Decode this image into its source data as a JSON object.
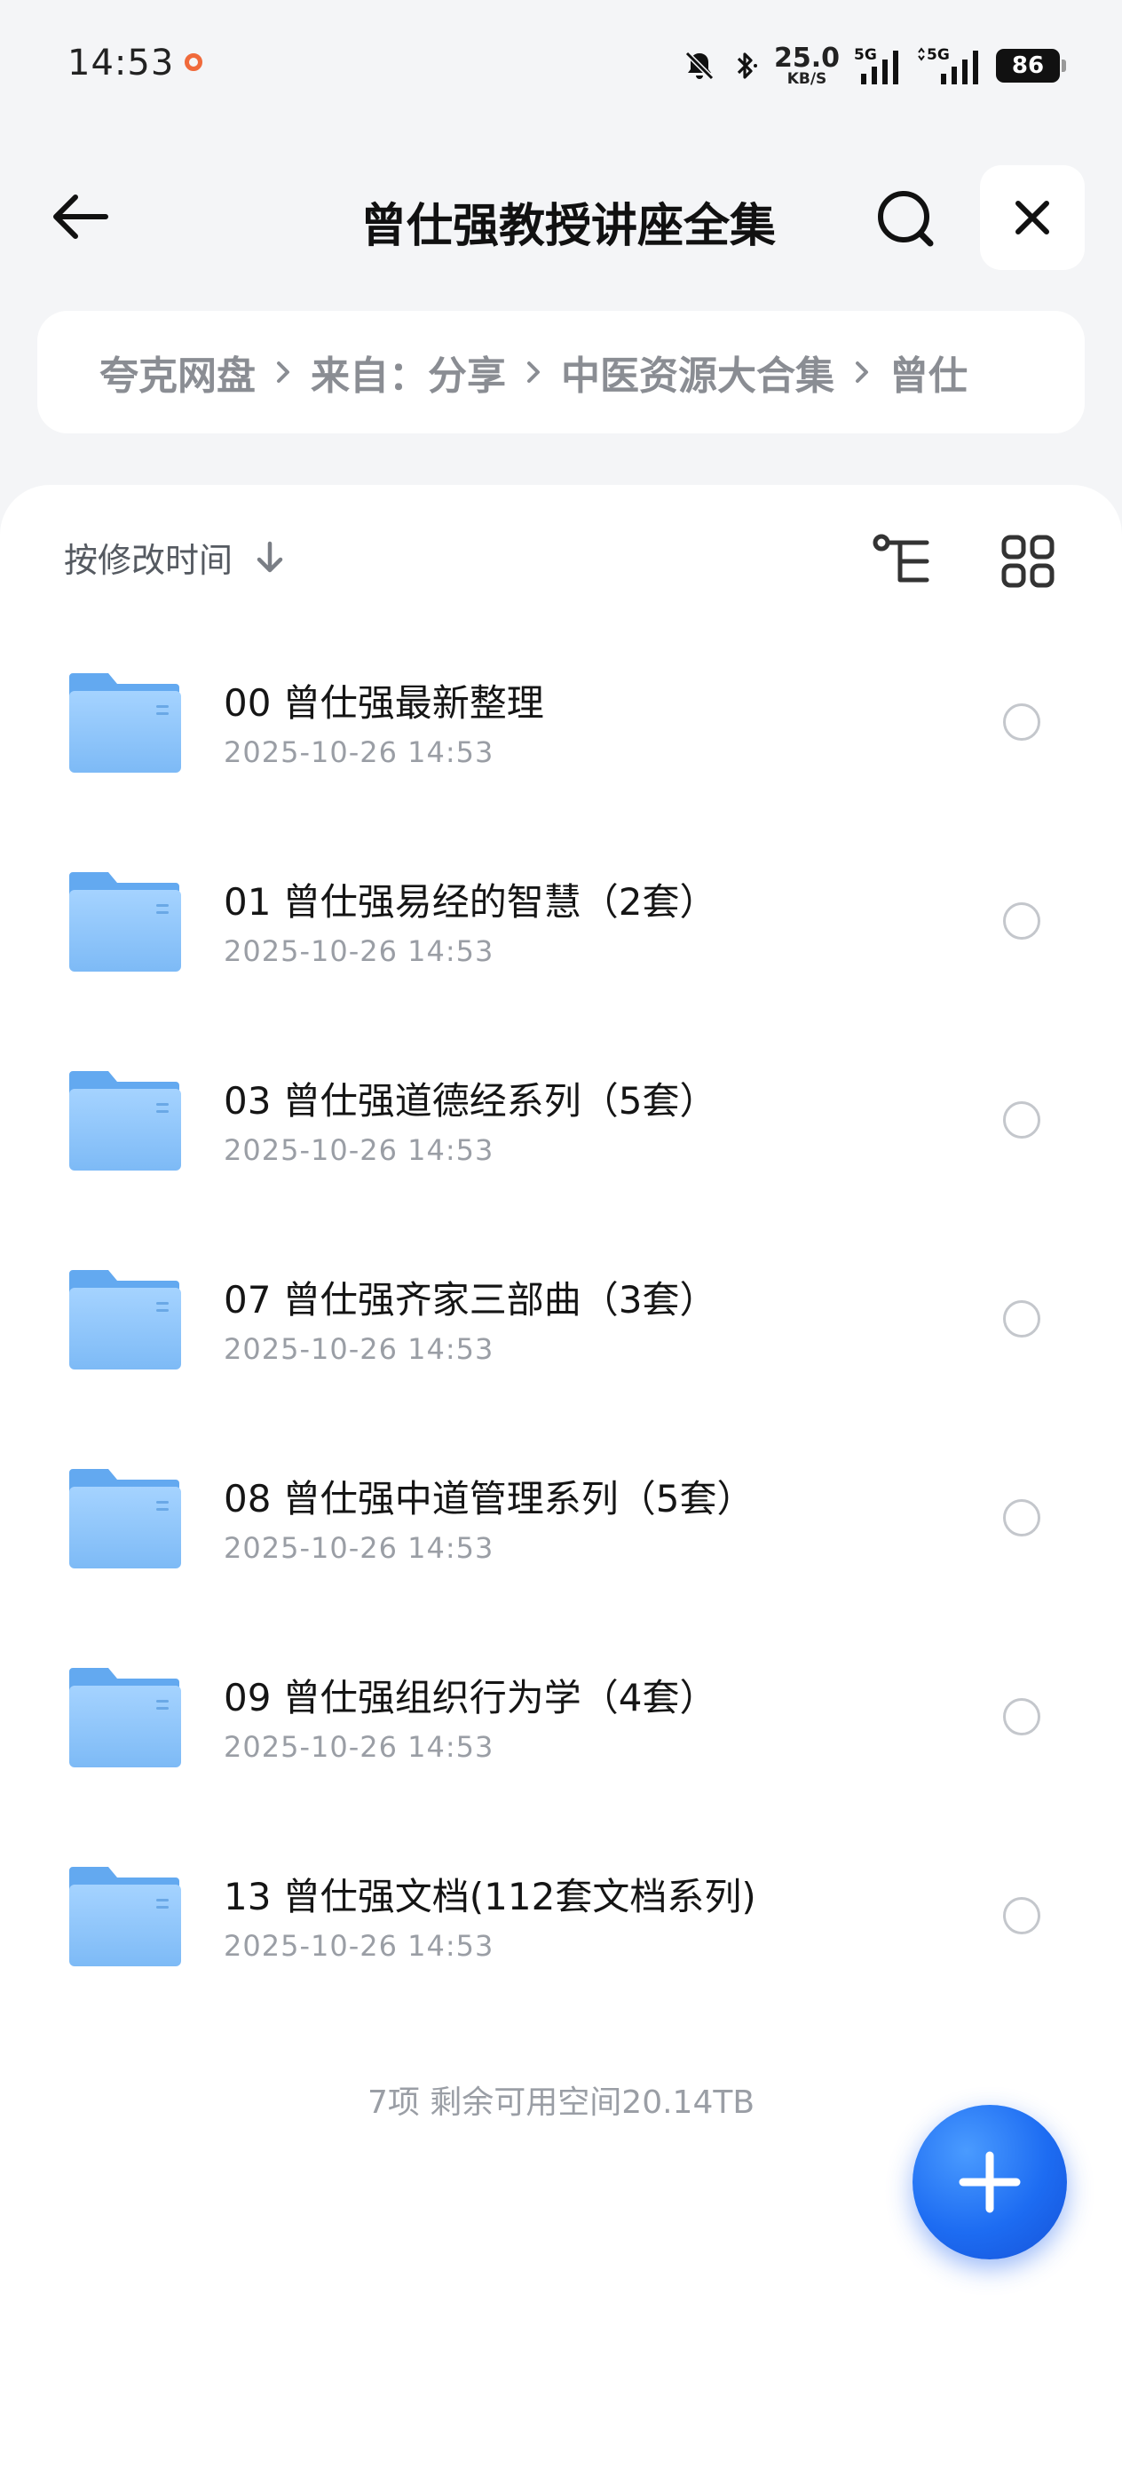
{
  "status_bar": {
    "time": "14:53",
    "net_speed_value": "25.0",
    "net_speed_unit": "KB/S",
    "signal1_label": "5G",
    "signal2_label": "5G",
    "battery": "86"
  },
  "header": {
    "title": "曾仕强教授讲座全集"
  },
  "breadcrumb": {
    "items": [
      "夸克网盘",
      "来自：分享",
      "中医资源大合集",
      "曾仕"
    ]
  },
  "toolbar": {
    "sort_label": "按修改时间"
  },
  "files": [
    {
      "name": "00 曾仕强最新整理",
      "date": "2025-10-26 14:53"
    },
    {
      "name": "01 曾仕强易经的智慧（2套）",
      "date": "2025-10-26 14:53"
    },
    {
      "name": "03 曾仕强道德经系列（5套）",
      "date": "2025-10-26 14:53"
    },
    {
      "name": "07 曾仕强齐家三部曲（3套）",
      "date": "2025-10-26 14:53"
    },
    {
      "name": "08 曾仕强中道管理系列（5套）",
      "date": "2025-10-26 14:53"
    },
    {
      "name": "09 曾仕强组织行为学（4套）",
      "date": "2025-10-26 14:53"
    },
    {
      "name": "13 曾仕强文档(112套文档系列)",
      "date": "2025-10-26 14:53"
    }
  ],
  "footer": {
    "summary": "7项 剩余可用空间20.14TB"
  },
  "colors": {
    "accent": "#1d6cf2",
    "folder": "#8ec5fa",
    "background": "#f4f5f7"
  },
  "icons": {
    "back": "arrow-left-icon",
    "search": "search-icon",
    "close": "close-icon",
    "sort": "arrow-down-icon",
    "tree": "tree-view-icon",
    "grid": "grid-view-icon",
    "folder": "folder-icon",
    "fab": "plus-icon"
  }
}
